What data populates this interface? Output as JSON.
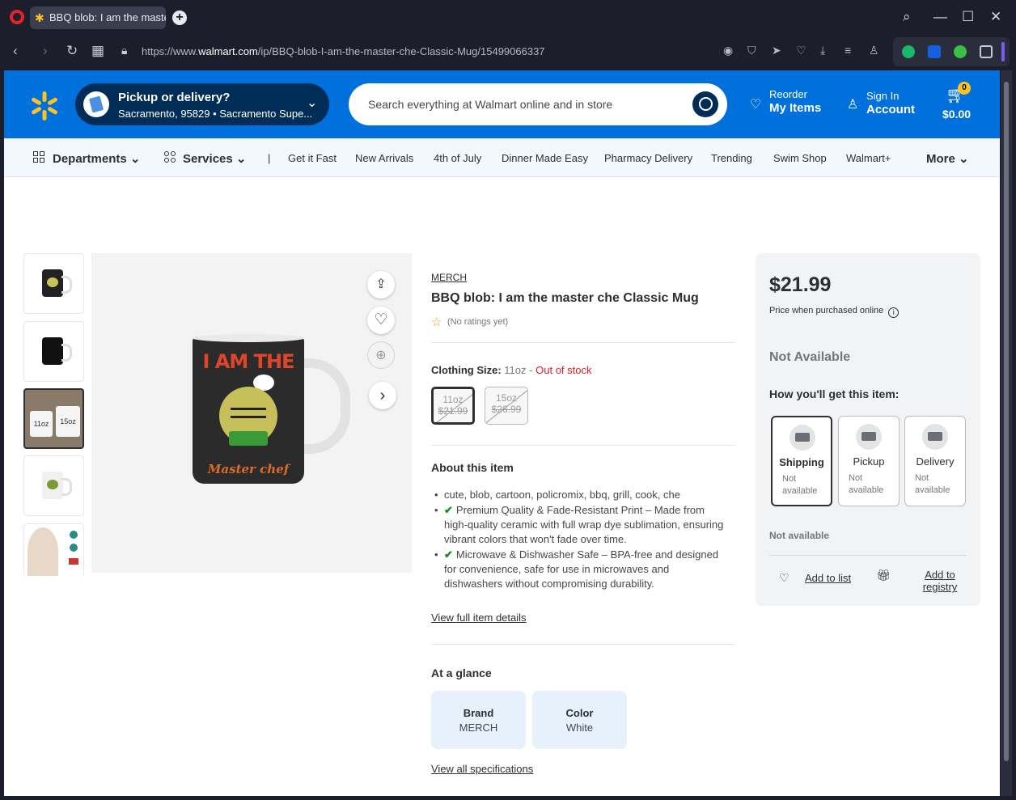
{
  "browser": {
    "tab_title": "BBQ blob: I am the master",
    "url_prefix": "https://www.",
    "url_domain": "walmart.com",
    "url_path": "/ip/BBQ-blob-I-am-the-master-che-Classic-Mug/15499066337"
  },
  "header": {
    "pickup_title": "Pickup or delivery?",
    "pickup_location": "Sacramento, 95829 • Sacramento Supe...",
    "search_placeholder": "Search everything at Walmart online and in store",
    "reorder_top": "Reorder",
    "reorder_bottom": "My Items",
    "signin_top": "Sign In",
    "signin_bottom": "Account",
    "cart_count": "0",
    "cart_total": "$0.00"
  },
  "subnav": {
    "departments": "Departments",
    "services": "Services",
    "links": [
      "Get it Fast",
      "New Arrivals",
      "4th of July",
      "Dinner Made Easy",
      "Pharmacy Delivery",
      "Trending",
      "Swim Shop",
      "Walmart+"
    ],
    "more": "More"
  },
  "product": {
    "brand": "MERCH",
    "title": "BBQ blob: I am the master che Classic Mug",
    "rating_text": "(No ratings yet)",
    "size_label": "Clothing Size:",
    "size_value": "11oz",
    "size_sep": "-",
    "size_status": "Out of stock",
    "sizes": [
      {
        "size": "11oz",
        "price": "$21.99"
      },
      {
        "size": "15oz",
        "price": "$26.99"
      }
    ],
    "mug_print_title": "I AM THE",
    "mug_print_sub": "Master chef",
    "thumb_labels": [
      "11oz",
      "15oz"
    ],
    "about_heading": "About this item",
    "about_items": [
      "cute, blob, cartoon, policromix, bbq, grill, cook, che",
      "Premium Quality & Fade-Resistant Print – Made from high-quality ceramic with full wrap dye sublimation, ensuring vibrant colors that won't fade over time.",
      "Microwave & Dishwasher Safe – BPA-free and designed for convenience, safe for use in microwaves and dishwashers without compromising durability."
    ],
    "view_full_details": "View full item details",
    "glance_heading": "At a glance",
    "glance": [
      {
        "key": "Brand",
        "value": "MERCH"
      },
      {
        "key": "Color",
        "value": "White"
      }
    ],
    "view_all_specs": "View all specifications"
  },
  "buybox": {
    "price": "$21.99",
    "price_note": "Price when purchased online",
    "not_available_big": "Not Available",
    "how_heading": "How you'll get this item:",
    "options": [
      {
        "title": "Shipping",
        "status": "Not available"
      },
      {
        "title": "Pickup",
        "status": "Not available"
      },
      {
        "title": "Delivery",
        "status": "Not available"
      }
    ],
    "not_available_small": "Not available",
    "add_to_list": "Add to list",
    "add_to_registry": "Add to registry"
  },
  "colors": {
    "walmart_blue": "#0071dc",
    "walmart_navy": "#002d58",
    "spark_yellow": "#ffc220",
    "out_of_stock_red": "#de1c24"
  }
}
